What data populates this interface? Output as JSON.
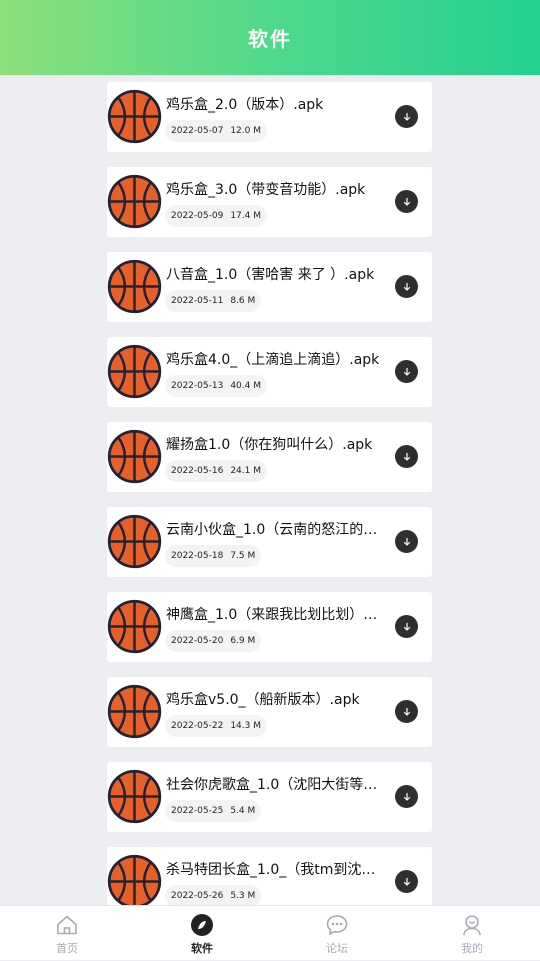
{
  "header": {
    "title": "软件"
  },
  "files": [
    {
      "name": "鸡乐盒_2.0（版本）.apk",
      "date": "2022-05-07",
      "size": "12.0 M"
    },
    {
      "name": "鸡乐盒_3.0（带变音功能）.apk",
      "date": "2022-05-09",
      "size": "17.4 M"
    },
    {
      "name": "八音盒_1.0（害哈害 来了 ）.apk",
      "date": "2022-05-11",
      "size": "8.6 M"
    },
    {
      "name": "鸡乐盒4.0_（上滴追上滴追）.apk",
      "date": "2022-05-13",
      "size": "40.4 M"
    },
    {
      "name": "耀扬盒1.0（你在狗叫什么）.apk",
      "date": "2022-05-16",
      "size": "24.1 M"
    },
    {
      "name": "云南小伙盒_1.0（云南的怒江的…",
      "date": "2022-05-18",
      "size": "7.5 M"
    },
    {
      "name": "神鹰盒_1.0（来跟我比划比划）.…",
      "date": "2022-05-20",
      "size": "6.9 M"
    },
    {
      "name": "鸡乐盒v5.0_（船新版本）.apk",
      "date": "2022-05-22",
      "size": "14.3 M"
    },
    {
      "name": "社会你虎歌盒_1.0（沈阳大街等…",
      "date": "2022-05-25",
      "size": "5.4 M"
    },
    {
      "name": "杀马特团长盒_1.0_（我tm到沈…",
      "date": "2022-05-26",
      "size": "5.3 M"
    }
  ],
  "icons": {
    "file_thumbnail": "basketball-icon",
    "download": "download-arrow-icon"
  },
  "tabbar": {
    "active_index": 1,
    "tabs": [
      {
        "label": "首页",
        "icon": "home-icon"
      },
      {
        "label": "软件",
        "icon": "software-icon"
      },
      {
        "label": "论坛",
        "icon": "forum-chat-icon"
      },
      {
        "label": "我的",
        "icon": "profile-icon"
      }
    ]
  },
  "colors": {
    "header_gradient_start": "#8ce07a",
    "header_gradient_end": "#23d08f",
    "active_tab": "#222222",
    "inactive_tab": "#a9a9b8",
    "basketball": "#e6602a"
  }
}
